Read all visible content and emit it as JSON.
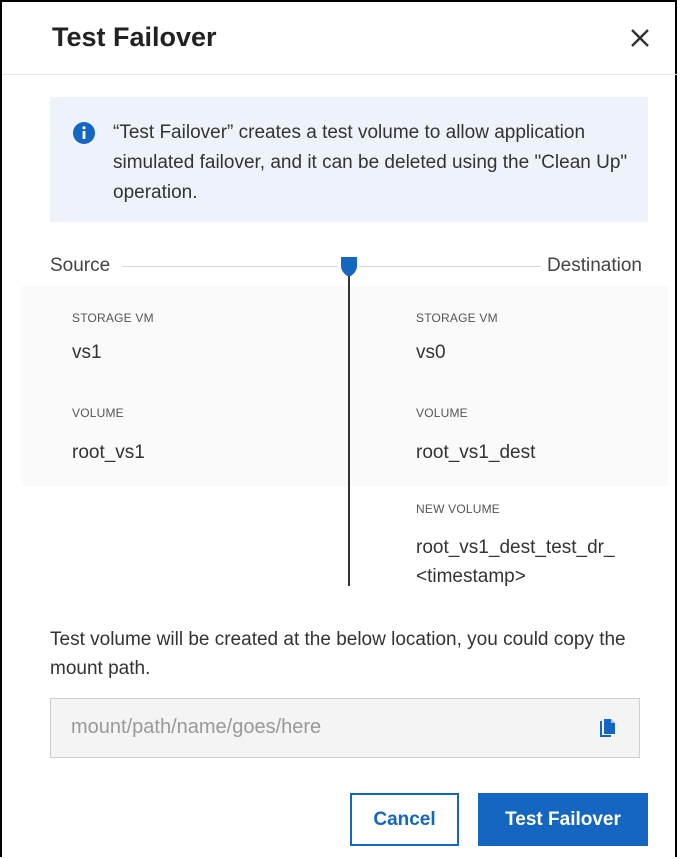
{
  "dialog": {
    "title": "Test Failover",
    "close_icon": "close-icon"
  },
  "info": {
    "icon": "info-icon",
    "text": "“Test Failover” creates a test volume to allow application simulated failover, and it can be deleted using the \"Clean Up\" operation."
  },
  "relationship": {
    "source_label": "Source",
    "destination_label": "Destination",
    "source": {
      "storage_vm_label": "STORAGE VM",
      "storage_vm": "vs1",
      "volume_label": "VOLUME",
      "volume": "root_vs1"
    },
    "destination": {
      "storage_vm_label": "STORAGE VM",
      "storage_vm": "vs0",
      "volume_label": "VOLUME",
      "volume": "root_vs1_dest",
      "new_volume_label": "NEW VOLUME",
      "new_volume_line1": "root_vs1_dest_test_dr_",
      "new_volume_line2": "<timestamp>"
    }
  },
  "mount": {
    "message": "Test volume will be created at the below location, you could copy the mount path.",
    "path_placeholder": "mount/path/name/goes/here",
    "copy_icon": "copy-icon"
  },
  "buttons": {
    "cancel": "Cancel",
    "confirm": "Test Failover"
  },
  "colors": {
    "accent": "#1566c0",
    "info_background": "#eef3fb"
  }
}
